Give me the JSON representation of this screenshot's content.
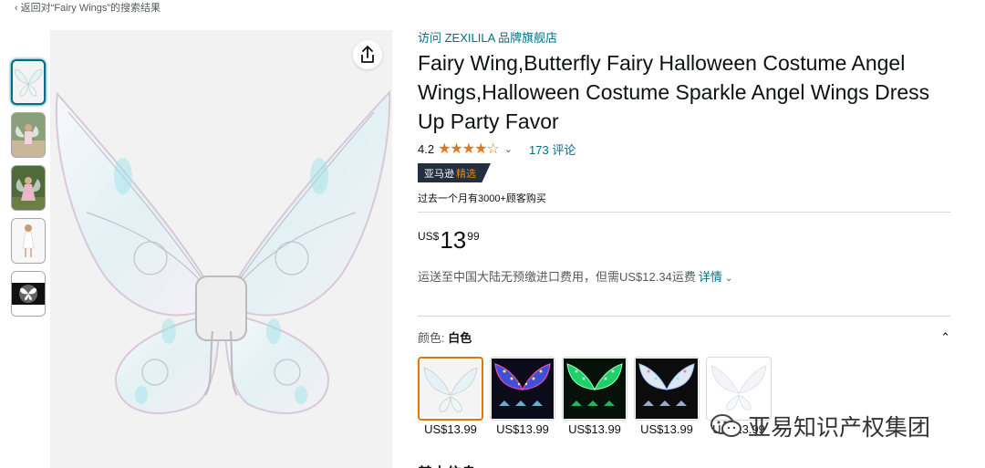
{
  "nav": {
    "back_label": "返回对“Fairy Wings”的搜索结果"
  },
  "thumbnails": [
    {
      "name": "wings-white"
    },
    {
      "name": "girl-pose"
    },
    {
      "name": "girl-garden"
    },
    {
      "name": "girl-white-dress"
    },
    {
      "name": "wings-play-video"
    }
  ],
  "product": {
    "store_link": "访问 ZEXILILA 品牌旗舰店",
    "title": "Fairy Wing,Butterfly Fairy Halloween Costume Angel Wings,Halloween Costume Sparkle Angel Wings Dress Up Party Favor",
    "rating": "4.2",
    "stars": "★★★★☆",
    "review_count": "173 评论",
    "badge_main": "亚马逊",
    "badge_accent": "精选",
    "bought_text": "过去一个月有3000+顾客购买",
    "price": {
      "currency": "US$",
      "whole": "13",
      "fraction": "99"
    },
    "shipping_text": "运送至中国大陆无预缴进口费用，但需US$12.34运费",
    "shipping_details": "详情",
    "color_label": "颜色:",
    "color_value": "白色"
  },
  "swatches": [
    {
      "price": "US$13.99",
      "style": "white"
    },
    {
      "price": "US$13.99",
      "style": "blue-led"
    },
    {
      "price": "US$13.99",
      "style": "green-led"
    },
    {
      "price": "US$13.99",
      "style": "white-led"
    },
    {
      "price": "US$13.99",
      "style": "white-plain"
    }
  ],
  "watermark": {
    "text": "亚易知识产权集团"
  },
  "section": {
    "partial_heading": "基本信息"
  },
  "colors": {
    "link": "#007185",
    "star": "#de7921",
    "badge_bg": "#232f3e",
    "badge_accent": "#f08804",
    "selected_border": "#e77600"
  }
}
